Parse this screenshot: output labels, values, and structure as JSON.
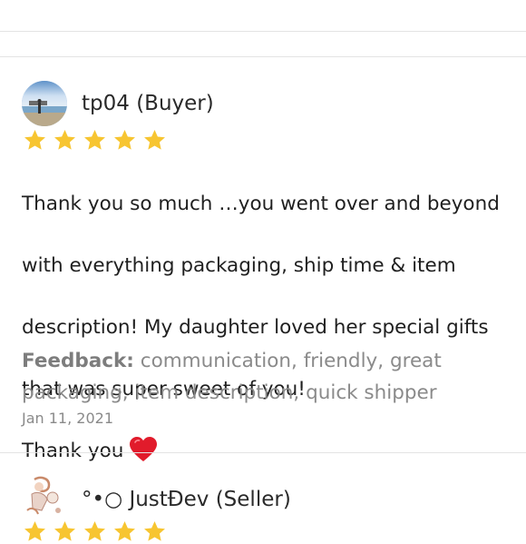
{
  "review1": {
    "username": "tp04 (Buyer)",
    "rating": 5,
    "text_lines": [
      "Thank you so much …you went over and beyond",
      "with everything packaging, ship time &  item",
      "description! My daughter loved her special gifts",
      "that was super sweet of you!",
      "Thank you"
    ],
    "feedback_label": "Feedback:",
    "feedback_text": " communication, friendly, great packaging, item description, quick shipper",
    "date": "Jan 11, 2021"
  },
  "review2": {
    "username": "°•○ JustĐev (Seller)"
  },
  "colors": {
    "star": "#f7c531",
    "heart": "#e11b2b",
    "divider": "#e3e3e3"
  }
}
